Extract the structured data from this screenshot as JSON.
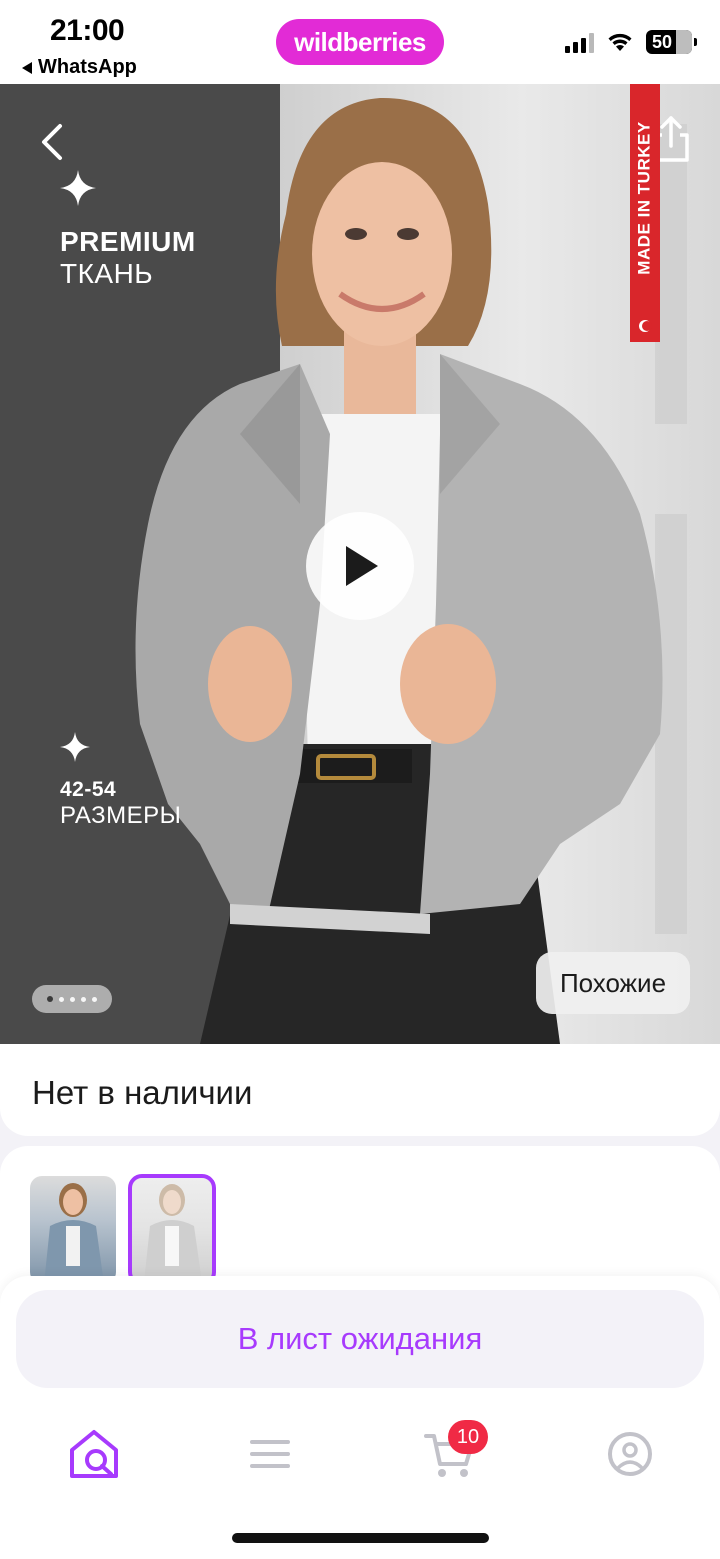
{
  "status_bar": {
    "time": "21:00",
    "back_app": "WhatsApp",
    "battery": "50",
    "logo": "wildberries"
  },
  "product_image": {
    "feature1": {
      "title": "PREMIUM",
      "subtitle": "ТКАНЬ"
    },
    "feature2": {
      "title": "42-54",
      "subtitle": "РАЗМЕРЫ"
    },
    "badge": "MADE IN TURKEY",
    "slides": 5,
    "current_slide": 1,
    "similar_button": "Похожие"
  },
  "stock": {
    "status": "Нет в наличии"
  },
  "color_variants": [
    {
      "name": "blue-denim",
      "selected": false
    },
    {
      "name": "grey-denim",
      "selected": true
    }
  ],
  "actions": {
    "wait_list": "В лист ожидания"
  },
  "tab_bar": {
    "items": [
      "home",
      "catalog",
      "cart",
      "profile"
    ],
    "active": "home",
    "cart_badge": "10"
  },
  "colors": {
    "accent": "#a73afd",
    "brand": "#e22bd6",
    "badge": "#f02a45",
    "made_in_badge": "#d9262b"
  }
}
